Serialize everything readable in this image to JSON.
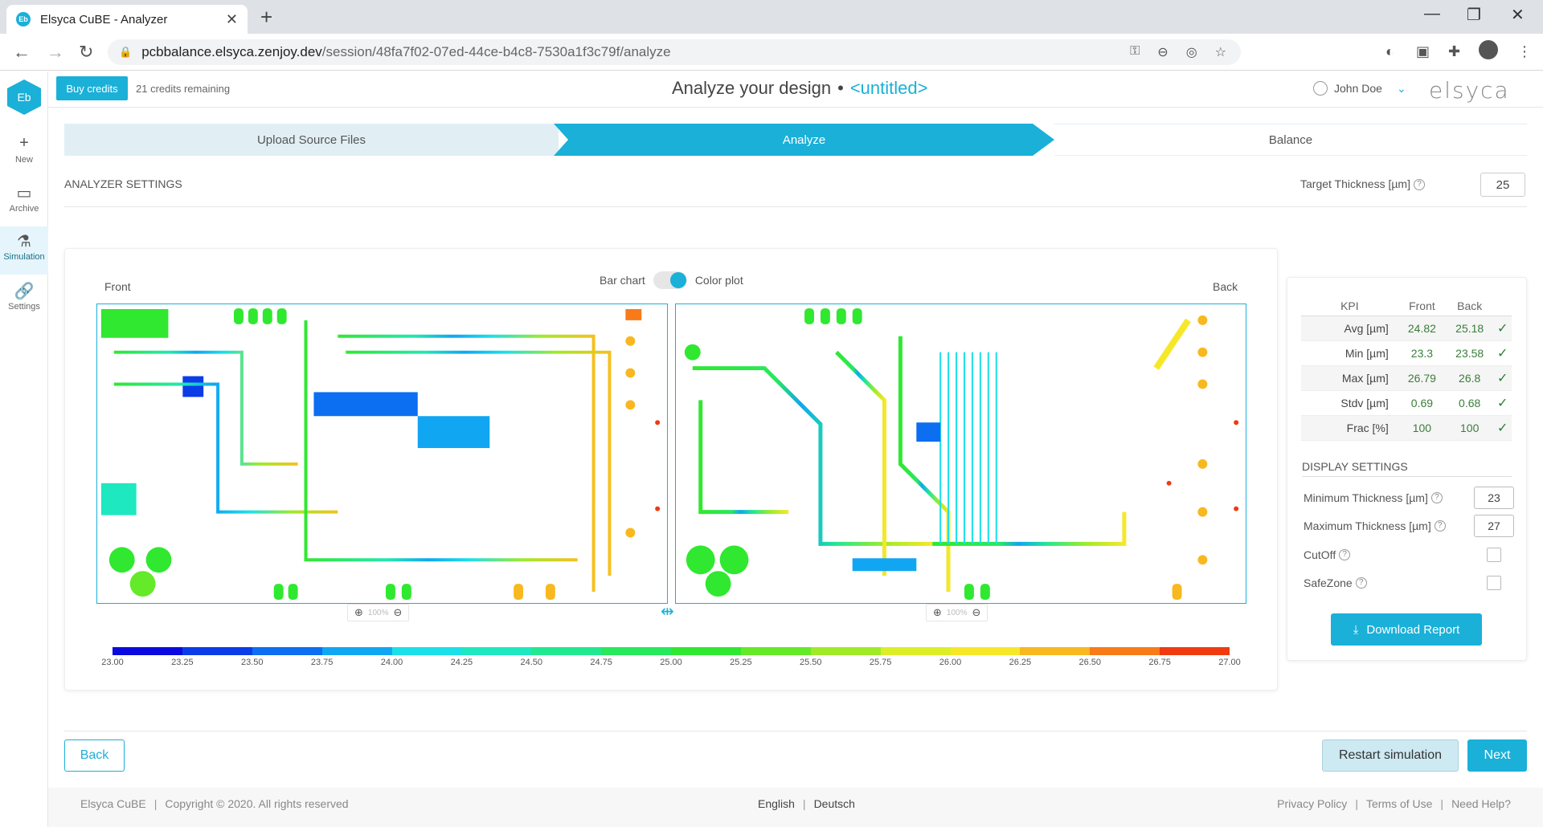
{
  "browser": {
    "tab_title": "Elsyca CuBE - Analyzer",
    "favicon_text": "Eb",
    "url_host": "pcbbalance.elsyca.zenjoy.dev",
    "url_path": "/session/48fa7f02-07ed-44ce-b4c8-7530a1f3c79f/analyze"
  },
  "sidebar": {
    "logo_text": "Eb",
    "items": [
      {
        "label": "New",
        "icon": "plus-icon"
      },
      {
        "label": "Archive",
        "icon": "archive-icon"
      },
      {
        "label": "Simulation",
        "icon": "flask-icon"
      },
      {
        "label": "Settings",
        "icon": "link-icon"
      }
    ]
  },
  "header": {
    "buy_credits": "Buy credits",
    "credits_remaining": "21 credits remaining",
    "title": "Analyze your design",
    "dot": "•",
    "design_name": "<untitled>",
    "user_name": "John Doe",
    "brand": "elsyca"
  },
  "steps": [
    "Upload Source Files",
    "Analyze",
    "Balance"
  ],
  "settings": {
    "section_title": "ANALYZER SETTINGS",
    "target_label": "Target Thickness [µm]",
    "target_value": "25"
  },
  "plot": {
    "front_label": "Front",
    "back_label": "Back",
    "toggle_left": "Bar chart",
    "toggle_right": "Color plot",
    "zoom_text": "100%",
    "scale_ticks": [
      "23.00",
      "23.25",
      "23.50",
      "23.75",
      "24.00",
      "24.25",
      "24.50",
      "24.75",
      "25.00",
      "25.25",
      "25.50",
      "25.75",
      "26.00",
      "26.25",
      "26.50",
      "26.75",
      "27.00"
    ],
    "scale_colors": [
      "#0a0ae0",
      "#0b3ce8",
      "#0c6ef0",
      "#10a6f2",
      "#1ae0ea",
      "#1ee8c0",
      "#22e890",
      "#28e85c",
      "#30e830",
      "#64ea28",
      "#a0ea28",
      "#dcee28",
      "#f6e828",
      "#f8b820",
      "#f87a18",
      "#f03a10"
    ]
  },
  "kpi": {
    "headers": [
      "KPI",
      "Front",
      "Back"
    ],
    "rows": [
      {
        "metric": "Avg [µm]",
        "front": "24.82",
        "back": "25.18",
        "check": "✓"
      },
      {
        "metric": "Min [µm]",
        "front": "23.3",
        "back": "23.58",
        "check": "✓"
      },
      {
        "metric": "Max [µm]",
        "front": "26.79",
        "back": "26.8",
        "check": "✓"
      },
      {
        "metric": "Stdv [µm]",
        "front": "0.69",
        "back": "0.68",
        "check": "✓"
      },
      {
        "metric": "Frac [%]",
        "front": "100",
        "back": "100",
        "check": "✓"
      }
    ]
  },
  "display": {
    "title": "DISPLAY SETTINGS",
    "min_label": "Minimum Thickness [µm]",
    "min_value": "23",
    "max_label": "Maximum Thickness [µm]",
    "max_value": "27",
    "cutoff_label": "CutOff",
    "safezone_label": "SafeZone",
    "download": "Download Report"
  },
  "actions": {
    "back": "Back",
    "restart": "Restart simulation",
    "next": "Next"
  },
  "footer": {
    "product": "Elsyca CuBE",
    "copyright": "Copyright © 2020. All rights reserved",
    "lang_en": "English",
    "lang_de": "Deutsch",
    "privacy": "Privacy Policy",
    "terms": "Terms of Use",
    "help": "Need Help?"
  }
}
